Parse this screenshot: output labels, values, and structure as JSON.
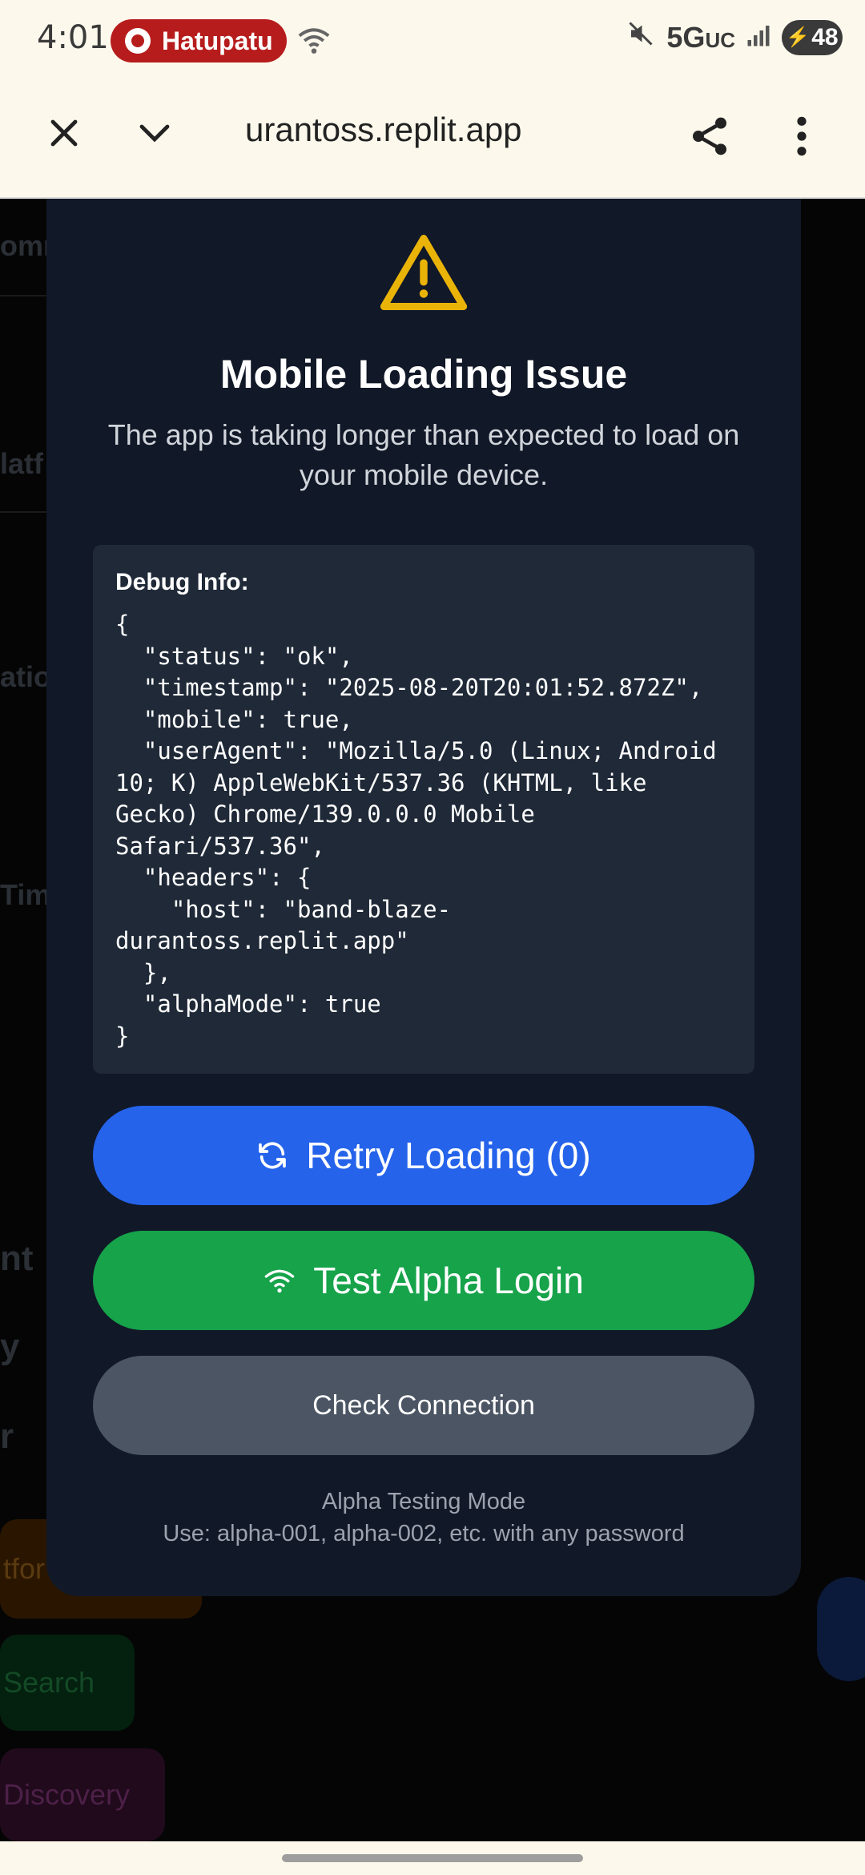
{
  "status_bar": {
    "time": "4:01",
    "recording_pill": "Hatupatu",
    "network": "5G",
    "network_suffix": "UC",
    "battery": "48"
  },
  "browser": {
    "url": "urantoss.replit.app",
    "close_icon": "close-icon",
    "menu_icon": "chevron-down-icon"
  },
  "background_fragments": [
    "omm",
    "latf",
    "atio",
    "Tim",
    "nt",
    "y",
    "r",
    "tfor",
    "Search",
    "Discovery"
  ],
  "modal": {
    "title": "Mobile Loading Issue",
    "description": "The app is taking longer than expected to load on your mobile device.",
    "debug_label": "Debug Info:",
    "debug_text": "{\n  \"status\": \"ok\",\n  \"timestamp\": \"2025-08-20T20:01:52.872Z\",\n  \"mobile\": true,\n  \"userAgent\": \"Mozilla/5.0 (Linux; Android 10; K) AppleWebKit/537.36 (KHTML, like Gecko) Chrome/139.0.0.0 Mobile Safari/537.36\",\n  \"headers\": {\n    \"host\": \"band-blaze-durantoss.replit.app\"\n  },\n  \"alphaMode\": true\n}",
    "retry_button": "Retry Loading (0)",
    "alpha_button": "Test Alpha Login",
    "check_button": "Check Connection",
    "footer_line1": "Alpha Testing Mode",
    "footer_line2": "Use: alpha-001, alpha-002, etc. with any password"
  },
  "colors": {
    "warning": "#eab308",
    "retry": "#2563eb",
    "alpha": "#16a34a",
    "check": "#4b5563"
  }
}
